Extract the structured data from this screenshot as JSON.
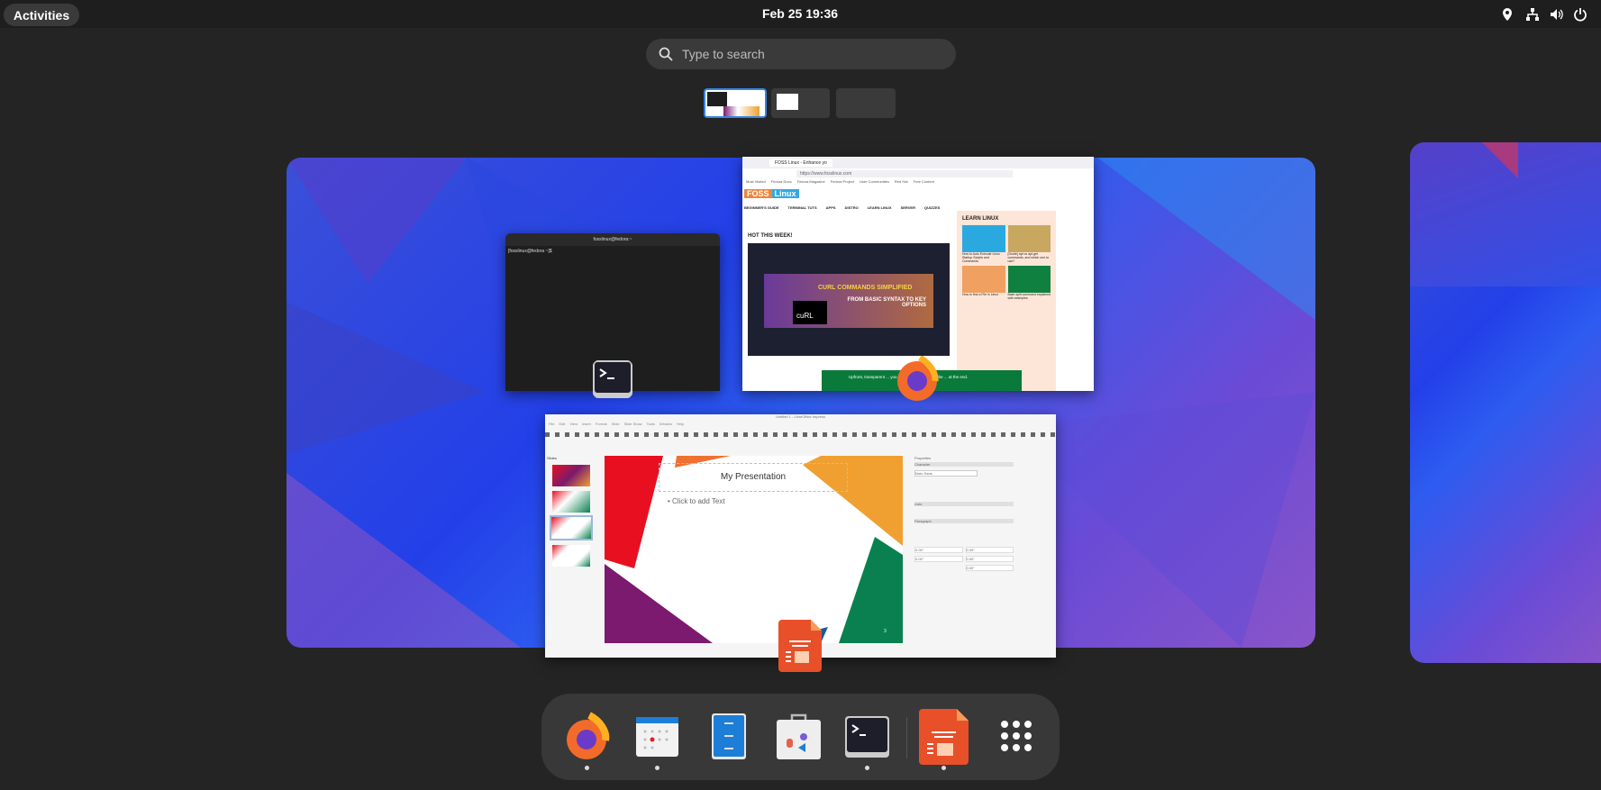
{
  "topbar": {
    "activities": "Activities",
    "clock": "Feb 25  19:36",
    "tray_icons": [
      "location-icon",
      "network-icon",
      "volume-icon",
      "power-icon"
    ]
  },
  "search": {
    "placeholder": "Type to search"
  },
  "workspaces": {
    "count": 3,
    "active": 1
  },
  "windows": {
    "firefox": {
      "tab": "FOSS Linux - Enhance yo",
      "url": "https://www.fosslinux.com",
      "bookmarks": [
        "Most Visited",
        "Fedora Docs",
        "Fedora Magazine",
        "Fedora Project",
        "User Communities",
        "Red Hat",
        "Free Content"
      ],
      "logo_left": "FOSS",
      "logo_right": "Linux",
      "nav": [
        "BEGINNER'S GUIDE",
        "TERMINAL TUTS",
        "APPS",
        "DISTRO",
        "LEARN LINUX",
        "SERVER",
        "QUIZZES"
      ],
      "hot": "HOT THIS WEEK!",
      "banner_line1": "CURL COMMANDS SIMPLIFIED",
      "banner_line2": "FROM BASIC SYNTAX TO KEY OPTIONS",
      "banner_tool": "cuRL",
      "sidebar_title": "LEARN LINUX",
      "articles": [
        "How to Auto Execute Linux Startup Scripts and Commands",
        "[Guide] apt vs apt-get commands, and which one to use?",
        "How to find a File in Linux",
        "Bash split command explained with examples"
      ],
      "ad": "Upfront, transparent ... you won't be surprised by the ... at the end."
    },
    "terminal": {
      "title": "fosslinux@fedora:~",
      "prompt": "[fosslinux@fedora ~]$"
    },
    "impress": {
      "title": "Untitled 1 - LibreOffice Impress",
      "menu": [
        "File",
        "Edit",
        "View",
        "Insert",
        "Format",
        "Slide",
        "Slide Show",
        "Tools",
        "Window",
        "Help"
      ],
      "slides_label": "Slides",
      "slide_title": "My Presentation",
      "slide_body": "Click to add Text",
      "slide_number": "3",
      "properties": "Properties",
      "sections": [
        "Character",
        "Lists",
        "Paragraph"
      ],
      "font": "Noto Sans",
      "spacing_values": [
        "0.00\"",
        "0.00\"",
        "0.00\"",
        "0.00\"",
        "0.00\""
      ]
    }
  },
  "dock": {
    "apps": [
      {
        "name": "Firefox",
        "icon": "firefox-icon",
        "running": true
      },
      {
        "name": "Calendar",
        "icon": "calendar-icon",
        "running": true
      },
      {
        "name": "Files",
        "icon": "files-icon",
        "running": false
      },
      {
        "name": "Software",
        "icon": "software-icon",
        "running": false
      },
      {
        "name": "Terminal",
        "icon": "terminal-icon",
        "running": true
      },
      {
        "name": "LibreOffice Impress",
        "icon": "impress-icon",
        "running": true
      },
      {
        "name": "Show Apps",
        "icon": "app-grid-icon",
        "running": false
      }
    ]
  },
  "colors": {
    "accent": "#3584e4",
    "dock_bg": "#383838",
    "panel_bg": "#1e1e1e"
  }
}
